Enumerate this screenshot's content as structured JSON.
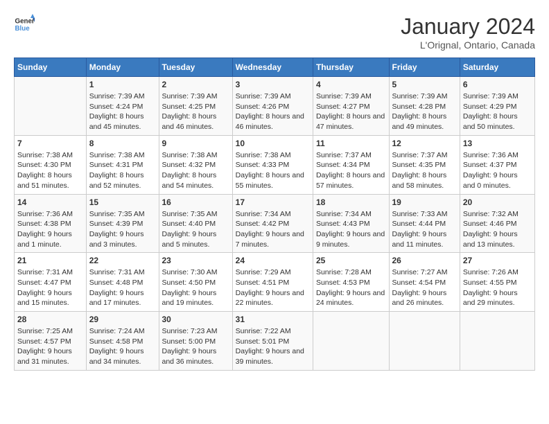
{
  "header": {
    "logo_line1": "General",
    "logo_line2": "Blue",
    "month": "January 2024",
    "location": "L'Orignal, Ontario, Canada"
  },
  "days_of_week": [
    "Sunday",
    "Monday",
    "Tuesday",
    "Wednesday",
    "Thursday",
    "Friday",
    "Saturday"
  ],
  "weeks": [
    [
      {
        "day": "",
        "sunrise": "",
        "sunset": "",
        "daylight": ""
      },
      {
        "day": "1",
        "sunrise": "Sunrise: 7:39 AM",
        "sunset": "Sunset: 4:24 PM",
        "daylight": "Daylight: 8 hours and 45 minutes."
      },
      {
        "day": "2",
        "sunrise": "Sunrise: 7:39 AM",
        "sunset": "Sunset: 4:25 PM",
        "daylight": "Daylight: 8 hours and 46 minutes."
      },
      {
        "day": "3",
        "sunrise": "Sunrise: 7:39 AM",
        "sunset": "Sunset: 4:26 PM",
        "daylight": "Daylight: 8 hours and 46 minutes."
      },
      {
        "day": "4",
        "sunrise": "Sunrise: 7:39 AM",
        "sunset": "Sunset: 4:27 PM",
        "daylight": "Daylight: 8 hours and 47 minutes."
      },
      {
        "day": "5",
        "sunrise": "Sunrise: 7:39 AM",
        "sunset": "Sunset: 4:28 PM",
        "daylight": "Daylight: 8 hours and 49 minutes."
      },
      {
        "day": "6",
        "sunrise": "Sunrise: 7:39 AM",
        "sunset": "Sunset: 4:29 PM",
        "daylight": "Daylight: 8 hours and 50 minutes."
      }
    ],
    [
      {
        "day": "7",
        "sunrise": "Sunrise: 7:38 AM",
        "sunset": "Sunset: 4:30 PM",
        "daylight": "Daylight: 8 hours and 51 minutes."
      },
      {
        "day": "8",
        "sunrise": "Sunrise: 7:38 AM",
        "sunset": "Sunset: 4:31 PM",
        "daylight": "Daylight: 8 hours and 52 minutes."
      },
      {
        "day": "9",
        "sunrise": "Sunrise: 7:38 AM",
        "sunset": "Sunset: 4:32 PM",
        "daylight": "Daylight: 8 hours and 54 minutes."
      },
      {
        "day": "10",
        "sunrise": "Sunrise: 7:38 AM",
        "sunset": "Sunset: 4:33 PM",
        "daylight": "Daylight: 8 hours and 55 minutes."
      },
      {
        "day": "11",
        "sunrise": "Sunrise: 7:37 AM",
        "sunset": "Sunset: 4:34 PM",
        "daylight": "Daylight: 8 hours and 57 minutes."
      },
      {
        "day": "12",
        "sunrise": "Sunrise: 7:37 AM",
        "sunset": "Sunset: 4:35 PM",
        "daylight": "Daylight: 8 hours and 58 minutes."
      },
      {
        "day": "13",
        "sunrise": "Sunrise: 7:36 AM",
        "sunset": "Sunset: 4:37 PM",
        "daylight": "Daylight: 9 hours and 0 minutes."
      }
    ],
    [
      {
        "day": "14",
        "sunrise": "Sunrise: 7:36 AM",
        "sunset": "Sunset: 4:38 PM",
        "daylight": "Daylight: 9 hours and 1 minute."
      },
      {
        "day": "15",
        "sunrise": "Sunrise: 7:35 AM",
        "sunset": "Sunset: 4:39 PM",
        "daylight": "Daylight: 9 hours and 3 minutes."
      },
      {
        "day": "16",
        "sunrise": "Sunrise: 7:35 AM",
        "sunset": "Sunset: 4:40 PM",
        "daylight": "Daylight: 9 hours and 5 minutes."
      },
      {
        "day": "17",
        "sunrise": "Sunrise: 7:34 AM",
        "sunset": "Sunset: 4:42 PM",
        "daylight": "Daylight: 9 hours and 7 minutes."
      },
      {
        "day": "18",
        "sunrise": "Sunrise: 7:34 AM",
        "sunset": "Sunset: 4:43 PM",
        "daylight": "Daylight: 9 hours and 9 minutes."
      },
      {
        "day": "19",
        "sunrise": "Sunrise: 7:33 AM",
        "sunset": "Sunset: 4:44 PM",
        "daylight": "Daylight: 9 hours and 11 minutes."
      },
      {
        "day": "20",
        "sunrise": "Sunrise: 7:32 AM",
        "sunset": "Sunset: 4:46 PM",
        "daylight": "Daylight: 9 hours and 13 minutes."
      }
    ],
    [
      {
        "day": "21",
        "sunrise": "Sunrise: 7:31 AM",
        "sunset": "Sunset: 4:47 PM",
        "daylight": "Daylight: 9 hours and 15 minutes."
      },
      {
        "day": "22",
        "sunrise": "Sunrise: 7:31 AM",
        "sunset": "Sunset: 4:48 PM",
        "daylight": "Daylight: 9 hours and 17 minutes."
      },
      {
        "day": "23",
        "sunrise": "Sunrise: 7:30 AM",
        "sunset": "Sunset: 4:50 PM",
        "daylight": "Daylight: 9 hours and 19 minutes."
      },
      {
        "day": "24",
        "sunrise": "Sunrise: 7:29 AM",
        "sunset": "Sunset: 4:51 PM",
        "daylight": "Daylight: 9 hours and 22 minutes."
      },
      {
        "day": "25",
        "sunrise": "Sunrise: 7:28 AM",
        "sunset": "Sunset: 4:53 PM",
        "daylight": "Daylight: 9 hours and 24 minutes."
      },
      {
        "day": "26",
        "sunrise": "Sunrise: 7:27 AM",
        "sunset": "Sunset: 4:54 PM",
        "daylight": "Daylight: 9 hours and 26 minutes."
      },
      {
        "day": "27",
        "sunrise": "Sunrise: 7:26 AM",
        "sunset": "Sunset: 4:55 PM",
        "daylight": "Daylight: 9 hours and 29 minutes."
      }
    ],
    [
      {
        "day": "28",
        "sunrise": "Sunrise: 7:25 AM",
        "sunset": "Sunset: 4:57 PM",
        "daylight": "Daylight: 9 hours and 31 minutes."
      },
      {
        "day": "29",
        "sunrise": "Sunrise: 7:24 AM",
        "sunset": "Sunset: 4:58 PM",
        "daylight": "Daylight: 9 hours and 34 minutes."
      },
      {
        "day": "30",
        "sunrise": "Sunrise: 7:23 AM",
        "sunset": "Sunset: 5:00 PM",
        "daylight": "Daylight: 9 hours and 36 minutes."
      },
      {
        "day": "31",
        "sunrise": "Sunrise: 7:22 AM",
        "sunset": "Sunset: 5:01 PM",
        "daylight": "Daylight: 9 hours and 39 minutes."
      },
      {
        "day": "",
        "sunrise": "",
        "sunset": "",
        "daylight": ""
      },
      {
        "day": "",
        "sunrise": "",
        "sunset": "",
        "daylight": ""
      },
      {
        "day": "",
        "sunrise": "",
        "sunset": "",
        "daylight": ""
      }
    ]
  ]
}
